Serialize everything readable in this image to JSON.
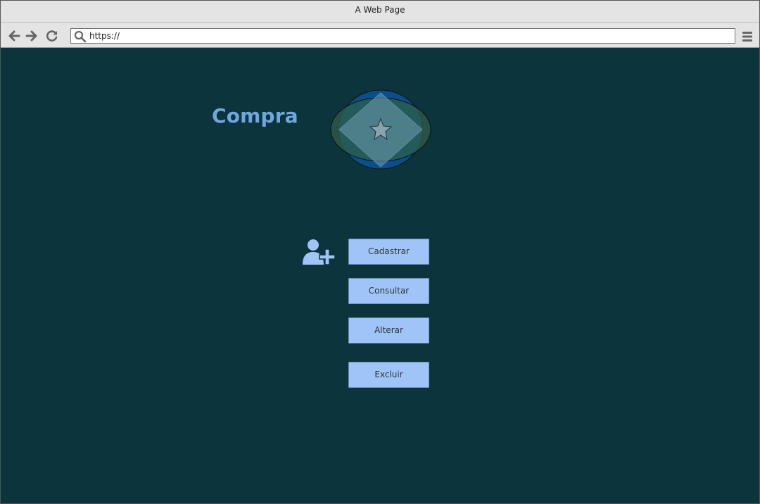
{
  "window": {
    "title": "A Web Page"
  },
  "toolbar": {
    "url": "https://",
    "back_icon": "arrow-left-icon",
    "forward_icon": "arrow-right-icon",
    "reload_icon": "reload-icon",
    "menu_icon": "hamburger-menu-icon",
    "search_icon": "search-icon"
  },
  "page": {
    "title": "Compra",
    "background": "#0c343d",
    "accent": "#6fa8dc",
    "logo_icon": "logo-image",
    "add_user_icon": "user-plus-icon"
  },
  "actions": {
    "register": "Cadastrar",
    "query": "Consultar",
    "edit": "Alterar",
    "delete": "Excluir",
    "button_color": "#9fc5f8"
  }
}
